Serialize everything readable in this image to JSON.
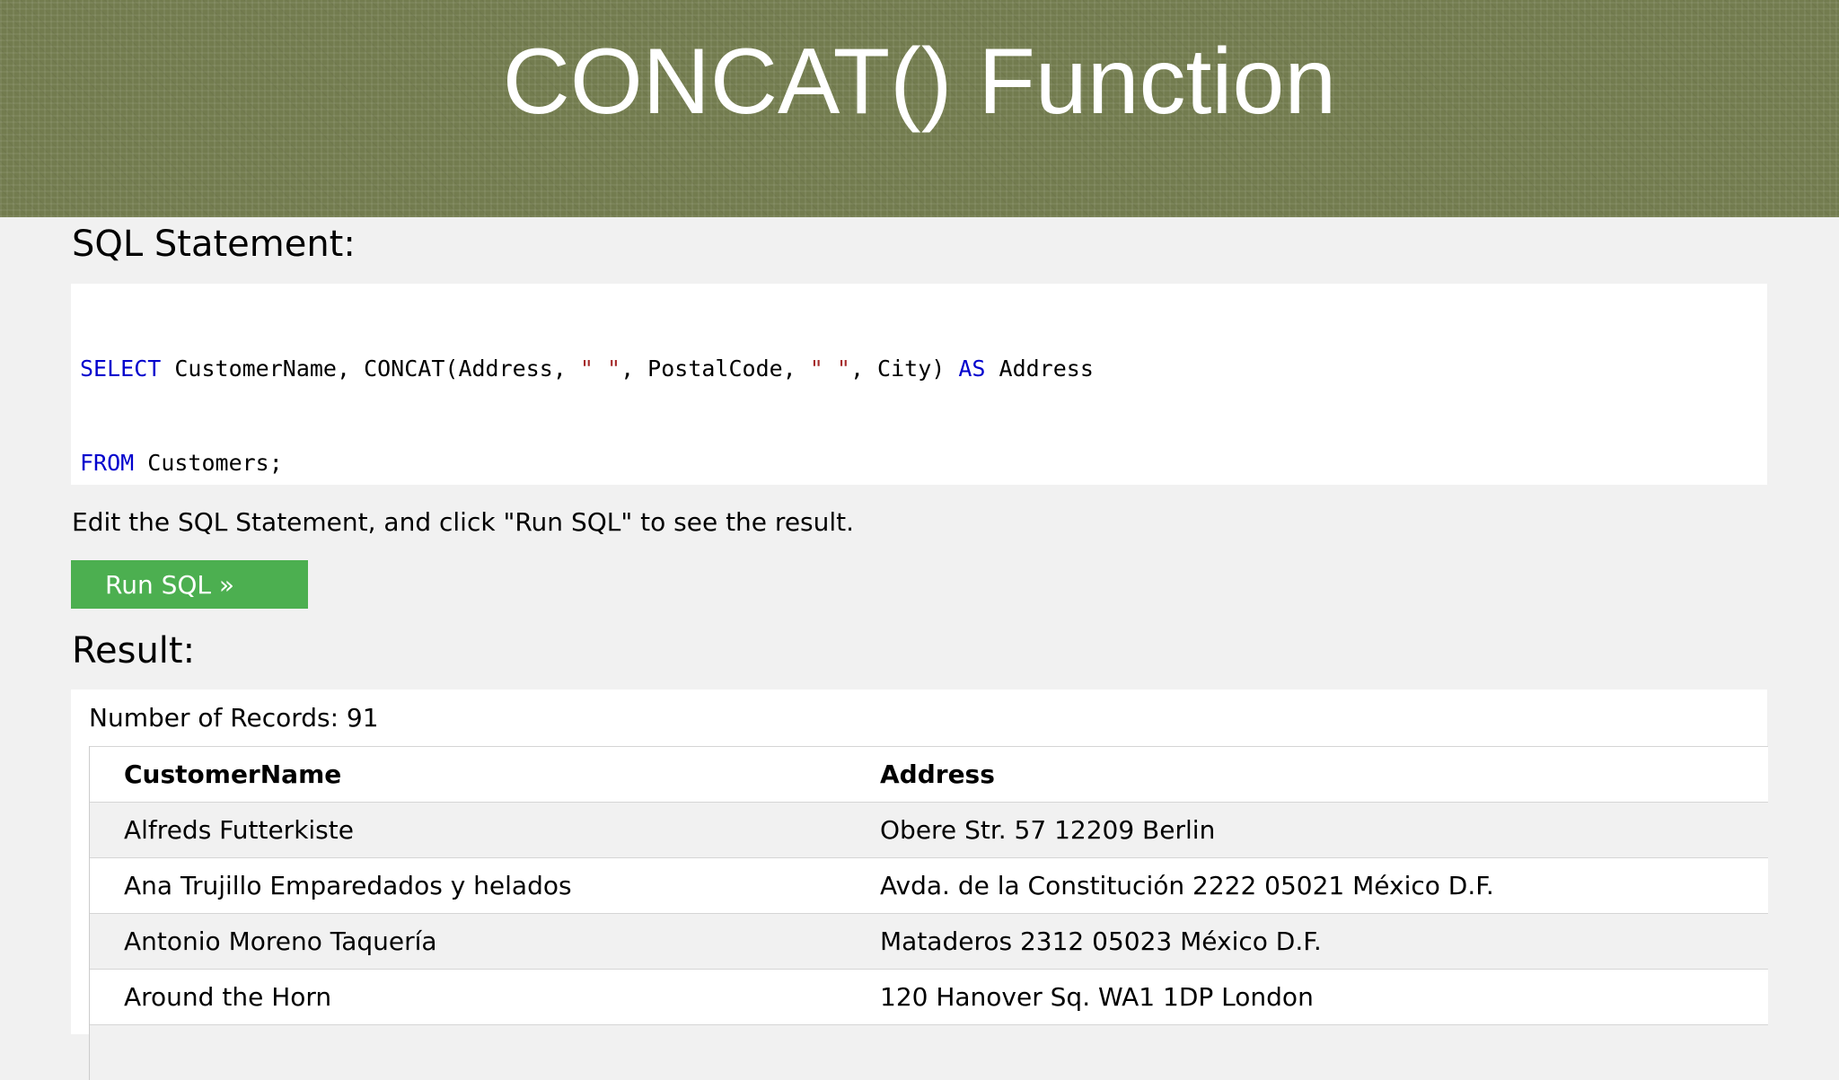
{
  "banner": {
    "title": "CONCAT() Function"
  },
  "sql_section": {
    "heading": "SQL Statement:",
    "editor": {
      "line1": {
        "kw_select": "SELECT",
        "t1": " CustomerName, CONCAT(Address, ",
        "s1": "\" \"",
        "t2": ", PostalCode, ",
        "s2": "\" \"",
        "t3": ", City) ",
        "kw_as": "AS",
        "t4": " Address"
      },
      "line2": {
        "kw_from": "FROM",
        "t1": " Customers;"
      }
    },
    "hint": "Edit the SQL Statement, and click \"Run SQL\" to see the result.",
    "run_button_label": "Run SQL »"
  },
  "result_section": {
    "heading": "Result:",
    "record_count": "Number of Records: 91",
    "columns": [
      "CustomerName",
      "Address"
    ],
    "rows": [
      [
        "Alfreds Futterkiste",
        "Obere Str. 57 12209 Berlin"
      ],
      [
        "Ana Trujillo Emparedados y helados",
        "Avda. de la Constitución 2222 05021 México D.F."
      ],
      [
        "Antonio Moreno Taquería",
        "Mataderos 2312 05023 México D.F."
      ],
      [
        "Around the Horn",
        "120 Hanover Sq. WA1 1DP London"
      ]
    ]
  },
  "colors": {
    "banner_bg": "#737c4f",
    "keyword": "#0000cd",
    "string": "#a52a2a",
    "button_bg": "#4caf50"
  }
}
